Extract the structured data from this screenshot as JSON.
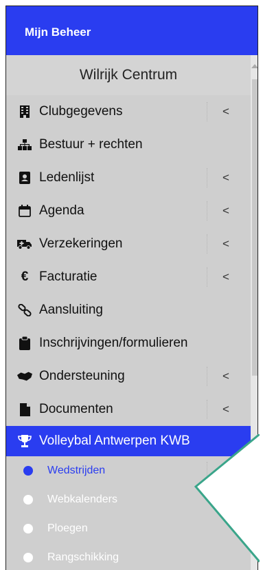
{
  "header": {
    "brand": "Mijn Beheer"
  },
  "club": {
    "name": "Wilrijk Centrum"
  },
  "menu": [
    {
      "label": "Clubgegevens",
      "icon": "building-icon",
      "has_chevron": true
    },
    {
      "label": "Bestuur + rechten",
      "icon": "sitemap-icon",
      "has_chevron": false
    },
    {
      "label": "Ledenlijst",
      "icon": "address-book-icon",
      "has_chevron": true
    },
    {
      "label": "Agenda",
      "icon": "calendar-icon",
      "has_chevron": true
    },
    {
      "label": "Verzekeringen",
      "icon": "ambulance-icon",
      "has_chevron": true
    },
    {
      "label": "Facturatie",
      "icon": "euro-icon",
      "has_chevron": true
    },
    {
      "label": "Aansluiting",
      "icon": "link-icon",
      "has_chevron": false
    },
    {
      "label": "Inschrijvingen/formulieren",
      "icon": "clipboard-icon",
      "has_chevron": false
    },
    {
      "label": "Ondersteuning",
      "icon": "handshake-icon",
      "has_chevron": true
    },
    {
      "label": "Documenten",
      "icon": "file-icon",
      "has_chevron": true
    }
  ],
  "active_section": {
    "label": "Volleybal Antwerpen KWB",
    "icon": "trophy-icon"
  },
  "submenu": [
    {
      "label": "Wedstrijden",
      "current": true
    },
    {
      "label": "Webkalenders",
      "current": false
    },
    {
      "label": "Ploegen",
      "current": false
    },
    {
      "label": "Rangschikking",
      "current": false
    }
  ],
  "chevron": "<",
  "colors": {
    "accent": "#2a3df0",
    "sidebar_bg": "#cfcfcf",
    "callout_stroke": "#3aa58a"
  }
}
